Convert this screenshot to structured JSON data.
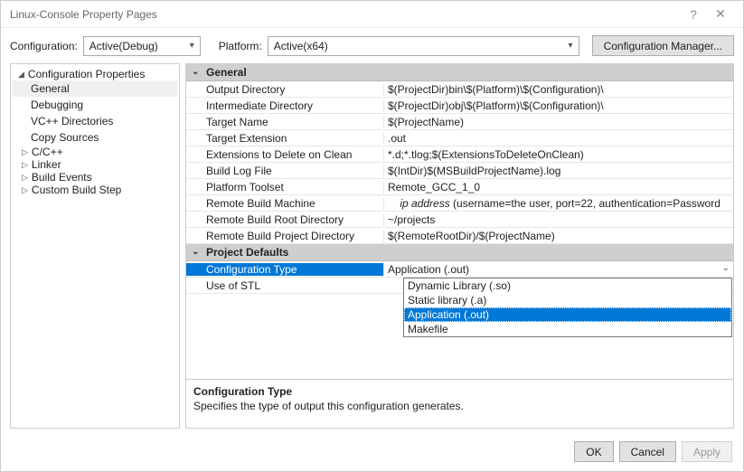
{
  "window": {
    "title": "Linux-Console Property Pages",
    "help_icon": "?",
    "close_icon": "✕"
  },
  "toolbar": {
    "config_label": "Configuration:",
    "config_value": "Active(Debug)",
    "platform_label": "Platform:",
    "platform_value": "Active(x64)",
    "config_mgr": "Configuration Manager..."
  },
  "tree": {
    "root": "Configuration Properties",
    "items": [
      {
        "label": "General",
        "selected": true
      },
      {
        "label": "Debugging"
      },
      {
        "label": "VC++ Directories"
      },
      {
        "label": "Copy Sources"
      },
      {
        "label": "C/C++",
        "expandable": true
      },
      {
        "label": "Linker",
        "expandable": true
      },
      {
        "label": "Build Events",
        "expandable": true
      },
      {
        "label": "Custom Build Step",
        "expandable": true
      }
    ]
  },
  "sections": {
    "general": {
      "header": "General",
      "rows": [
        {
          "k": "Output Directory",
          "v": "$(ProjectDir)bin\\$(Platform)\\$(Configuration)\\"
        },
        {
          "k": "Intermediate Directory",
          "v": "$(ProjectDir)obj\\$(Platform)\\$(Configuration)\\"
        },
        {
          "k": "Target Name",
          "v": "$(ProjectName)"
        },
        {
          "k": "Target Extension",
          "v": ".out"
        },
        {
          "k": "Extensions to Delete on Clean",
          "v": "*.d;*.tlog;$(ExtensionsToDeleteOnClean)"
        },
        {
          "k": "Build Log File",
          "v": "$(IntDir)$(MSBuildProjectName).log"
        },
        {
          "k": "Platform Toolset",
          "v": "Remote_GCC_1_0"
        },
        {
          "k": "Remote Build Machine",
          "v_prefix_italic": "ip address",
          "v_suffix": "    (username=the user, port=22, authentication=Password"
        },
        {
          "k": "Remote Build Root Directory",
          "v": "~/projects"
        },
        {
          "k": "Remote Build Project Directory",
          "v": "$(RemoteRootDir)/$(ProjectName)"
        }
      ]
    },
    "defaults": {
      "header": "Project Defaults",
      "rows": [
        {
          "k": "Configuration Type",
          "v": "Application (.out)",
          "selected": true,
          "has_dd": true
        },
        {
          "k": "Use of STL",
          "v": ""
        }
      ]
    }
  },
  "dropdown": {
    "items": [
      "Dynamic Library (.so)",
      "Static library (.a)",
      "Application (.out)",
      "Makefile"
    ],
    "selected_index": 2
  },
  "desc": {
    "title": "Configuration Type",
    "text": "Specifies the type of output this configuration generates."
  },
  "buttons": {
    "ok": "OK",
    "cancel": "Cancel",
    "apply": "Apply"
  }
}
